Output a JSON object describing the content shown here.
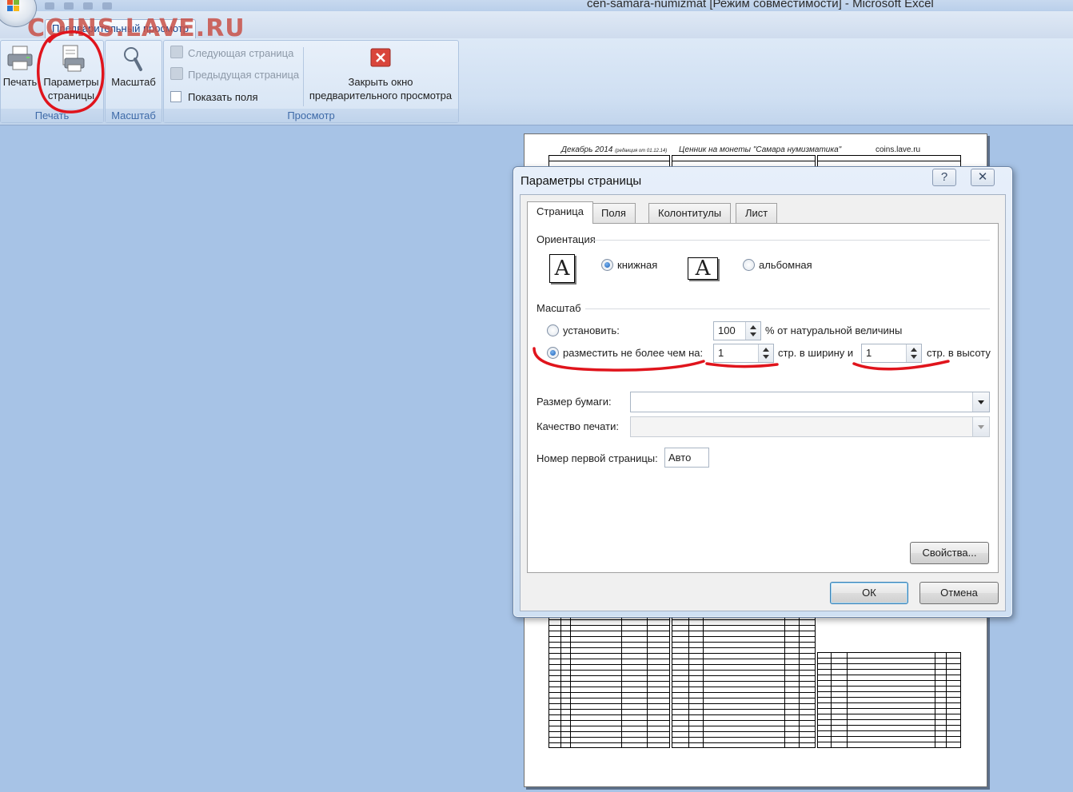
{
  "window": {
    "title": "cen-samara-numizmat  [Режим совместимости] - Microsoft Excel",
    "watermark": "COINS.LAVE.RU",
    "ribbon_tab": "Предварительный просмотр"
  },
  "ribbon": {
    "groups": {
      "print": {
        "label": "Печать",
        "print_button": "Печать",
        "page_setup_line1": "Параметры",
        "page_setup_line2": "страницы"
      },
      "zoom": {
        "label": "Масштаб",
        "zoom_button": "Масштаб"
      },
      "preview": {
        "label": "Просмотр",
        "next_page": "Следующая страница",
        "prev_page": "Предыдущая страница",
        "show_margins": "Показать поля",
        "close_line1": "Закрыть окно",
        "close_line2": "предварительного просмотра"
      }
    }
  },
  "preview_page": {
    "header_left": "Декабрь 2014",
    "header_left_small": "(редакция от 01.12.14)",
    "header_center": "Ценник на монеты \"Самара нумизматика\"",
    "header_right": "coins.lave.ru"
  },
  "dialog": {
    "title": "Параметры страницы",
    "help_icon": "?",
    "close_icon": "✕",
    "tabs": [
      "Страница",
      "Поля",
      "Колонтитулы",
      "Лист"
    ],
    "active_tab": "Страница",
    "orientation": {
      "heading": "Ориентация",
      "portrait": "книжная",
      "landscape": "альбомная",
      "selected": "portrait",
      "icon_glyph": "A"
    },
    "scale": {
      "heading": "Масштаб",
      "set_label": "установить:",
      "set_value": "100",
      "set_suffix": "% от натуральной величины",
      "fit_label": "разместить не более чем на:",
      "fit_width_value": "1",
      "fit_width_suffix": "стр. в ширину и",
      "fit_height_value": "1",
      "fit_height_suffix": "стр. в высоту",
      "selected": "fit"
    },
    "paper_size_label": "Размер бумаги:",
    "paper_size_value": "",
    "print_quality_label": "Качество печати:",
    "print_quality_value": "",
    "first_page_label": "Номер первой страницы:",
    "first_page_value": "Авто",
    "properties_button": "Свойства...",
    "ok_button": "ОК",
    "cancel_button": "Отмена"
  },
  "colors": {
    "workspace": "#a7c3e6",
    "annotation": "#e0141c",
    "group_label": "#3e6aa8"
  }
}
